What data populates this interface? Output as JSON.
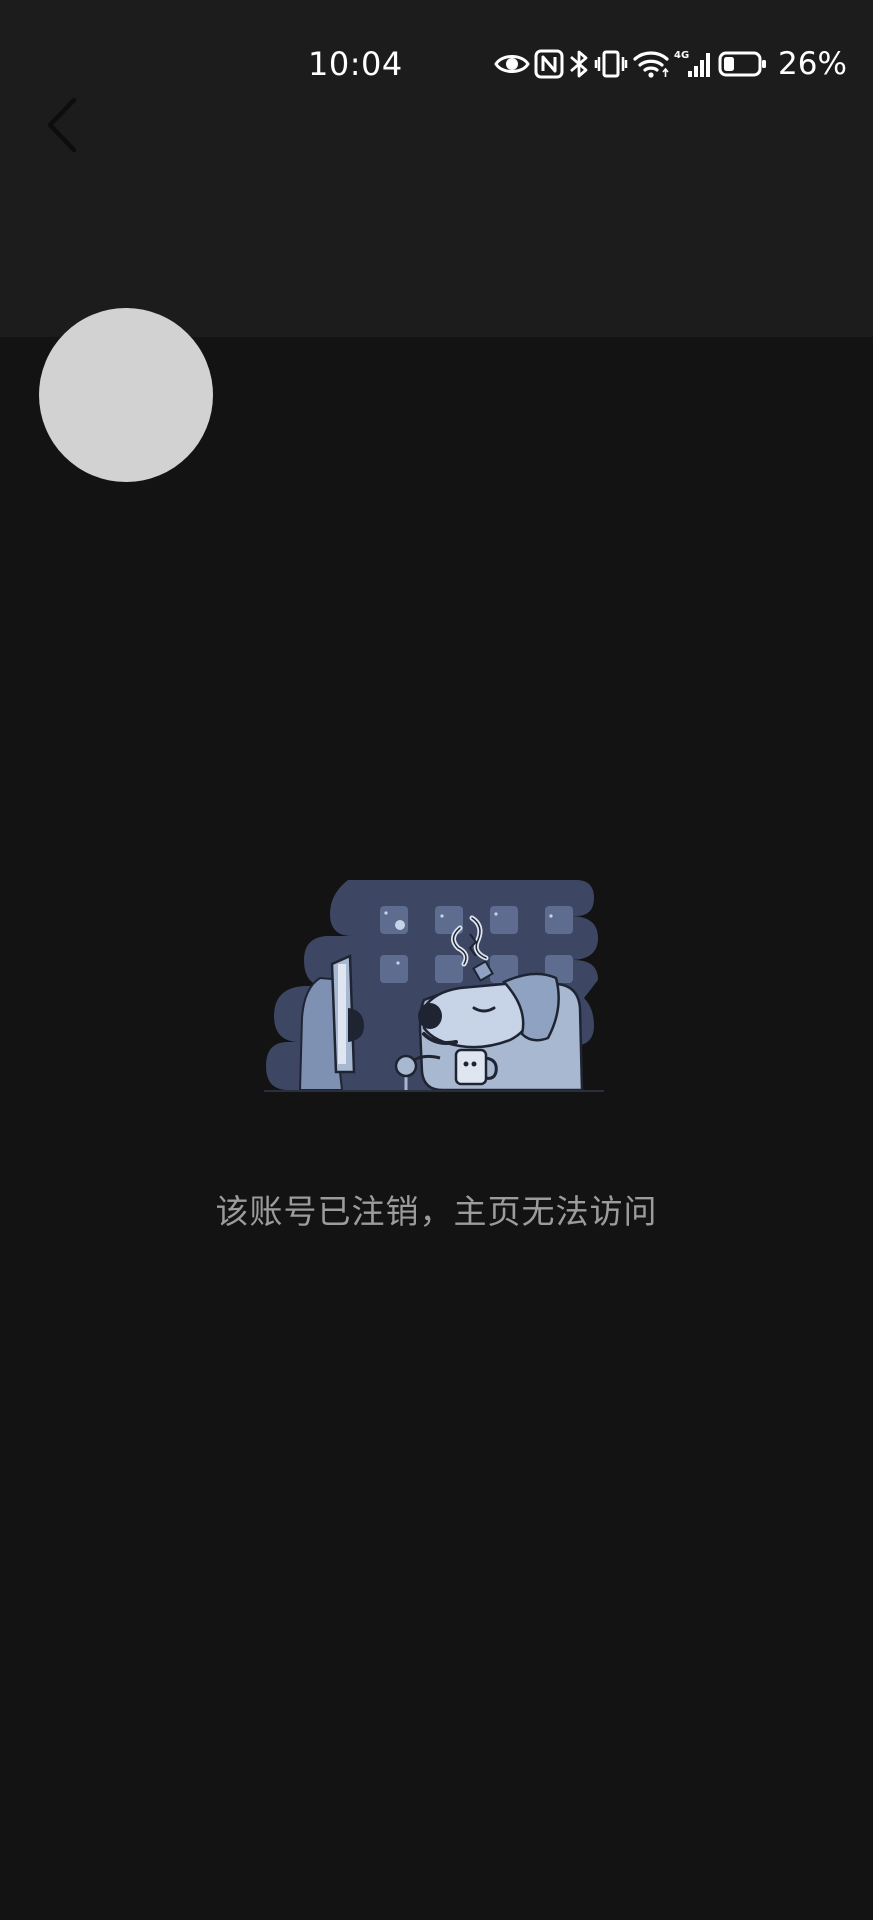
{
  "status_bar": {
    "time": "10:04",
    "network_label": "4G",
    "battery_percent": "26%",
    "battery_level": 0.26,
    "icons": [
      "eye-comfort-icon",
      "nfc-icon",
      "bluetooth-icon",
      "vibrate-icon",
      "wifi-icon",
      "cellular-signal-icon",
      "battery-icon"
    ]
  },
  "header": {
    "back_icon": "chevron-left-icon"
  },
  "profile": {
    "avatar_color": "#d2d2d2"
  },
  "empty_state": {
    "illustration": "sleepy-dog-at-computer-illustration",
    "message": "该账号已注销，主页无法访问"
  },
  "colors": {
    "background": "#131313",
    "header_background": "#1c1c1c",
    "message_text": "#9c9c9c",
    "illustration_primary": "#3d4763",
    "illustration_light": "#a8b8d0"
  }
}
